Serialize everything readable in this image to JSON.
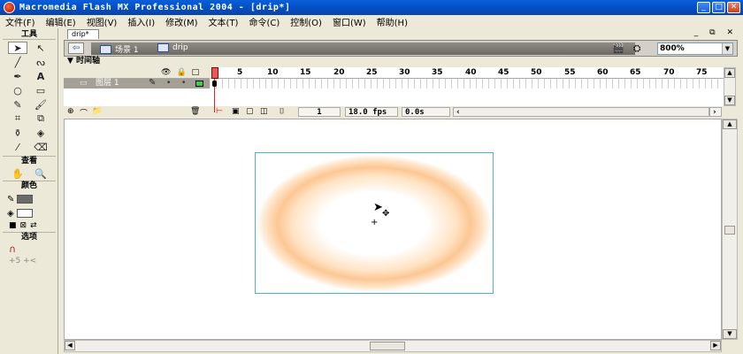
{
  "window": {
    "title": "Macromedia Flash MX Professional 2004 - [drip*]",
    "minimize": "_",
    "maximize": "□",
    "close": "✕"
  },
  "menu": [
    "文件(F)",
    "编辑(E)",
    "视图(V)",
    "插入(I)",
    "修改(M)",
    "文本(T)",
    "命令(C)",
    "控制(O)",
    "窗口(W)",
    "帮助(H)"
  ],
  "tools": {
    "header": "工具",
    "view_header": "查看",
    "colors_header": "颜色",
    "options_header": "选项",
    "options_symbols": "+5  +<"
  },
  "document": {
    "tab": "drip*",
    "scene": "场景 1",
    "symbol": "drip",
    "zoom": "800%"
  },
  "timeline": {
    "header": "▼ 时间轴",
    "layer_name": "图层 1",
    "ticks": [
      "1",
      "5",
      "10",
      "15",
      "20",
      "25",
      "30",
      "35",
      "40",
      "45",
      "50",
      "55",
      "60",
      "65",
      "70",
      "75"
    ],
    "current_frame": "1",
    "fps": "18.0 fps",
    "time": "0.0s"
  },
  "colors": {
    "accent": "#0451c8",
    "stage_border": "#4fb3c9",
    "gradient_ring": "#fcc793",
    "playhead": "#e85858",
    "layer_color": "#3ad048"
  }
}
